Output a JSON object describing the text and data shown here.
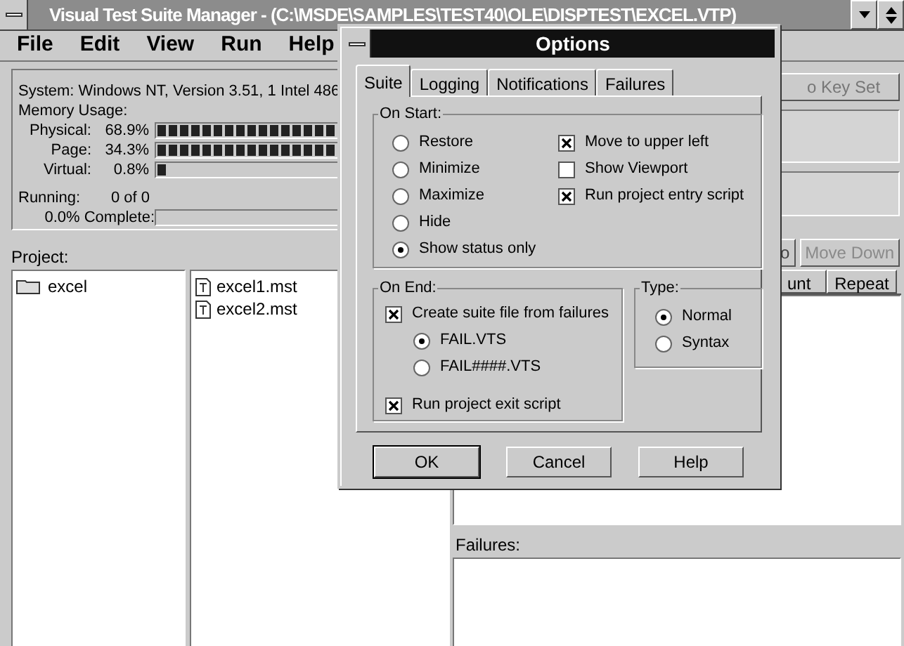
{
  "window": {
    "title": "Visual Test Suite Manager - (C:\\MSDE\\SAMPLES\\TEST40\\OLE\\DISPTEST\\EXCEL.VTP)"
  },
  "menu": [
    "File",
    "Edit",
    "View",
    "Run",
    "Help"
  ],
  "status": {
    "system": "System: Windows NT, Version 3.51, 1 Intel 486",
    "memory_label": "Memory Usage:",
    "meters": [
      {
        "label": "Physical:",
        "reading": "68.9%",
        "level": 0.689
      },
      {
        "label": "Page:",
        "reading": "34.3%",
        "level": 0.343
      },
      {
        "label": "Virtual:",
        "reading": "0.8%",
        "level": 0.008
      }
    ],
    "running_label": "Running:",
    "running_value": "0 of 0",
    "complete_label": "0.0% Complete:",
    "complete_bar": {
      "level": 0
    }
  },
  "key_set_button": "o Key Set",
  "project_label": "Project:",
  "tree": [
    {
      "name": "excel"
    }
  ],
  "files": [
    "excel1.mst",
    "excel2.mst"
  ],
  "order_buttons": [
    {
      "label": "o",
      "disabled": false
    },
    {
      "label": "Move Down",
      "disabled": true
    }
  ],
  "columns": [
    "unt",
    "Repeat"
  ],
  "failures_label": "Failures:",
  "dialog": {
    "title": "Options",
    "tabs": [
      {
        "label": "Suite",
        "selected": true
      },
      {
        "label": "Logging",
        "selected": false
      },
      {
        "label": "Notifications",
        "selected": false
      },
      {
        "label": "Failures",
        "selected": false
      }
    ],
    "on_start": {
      "label": "On Start:",
      "radios": [
        {
          "label": "Restore",
          "selected": false
        },
        {
          "label": "Minimize",
          "selected": false
        },
        {
          "label": "Maximize",
          "selected": false
        },
        {
          "label": "Hide",
          "selected": false
        },
        {
          "label": "Show status only",
          "selected": true
        }
      ],
      "checks": [
        {
          "label": "Move to upper left",
          "checked": true
        },
        {
          "label": "Show Viewport",
          "checked": false
        },
        {
          "label": "Run project entry script",
          "checked": true
        }
      ]
    },
    "on_end": {
      "label": "On End:",
      "create": {
        "label": "Create suite file from failures",
        "checked": true
      },
      "radios": [
        {
          "label": "FAIL.VTS",
          "selected": true
        },
        {
          "label": "FAIL####.VTS",
          "selected": false
        }
      ],
      "exit": {
        "label": "Run project exit script",
        "checked": true
      }
    },
    "type": {
      "label": "Type:",
      "radios": [
        {
          "label": "Normal",
          "selected": true
        },
        {
          "label": "Syntax",
          "selected": false
        }
      ]
    },
    "buttons": [
      {
        "label": "OK",
        "default": true
      },
      {
        "label": "Cancel",
        "default": false
      },
      {
        "label": "Help",
        "default": false
      }
    ]
  }
}
